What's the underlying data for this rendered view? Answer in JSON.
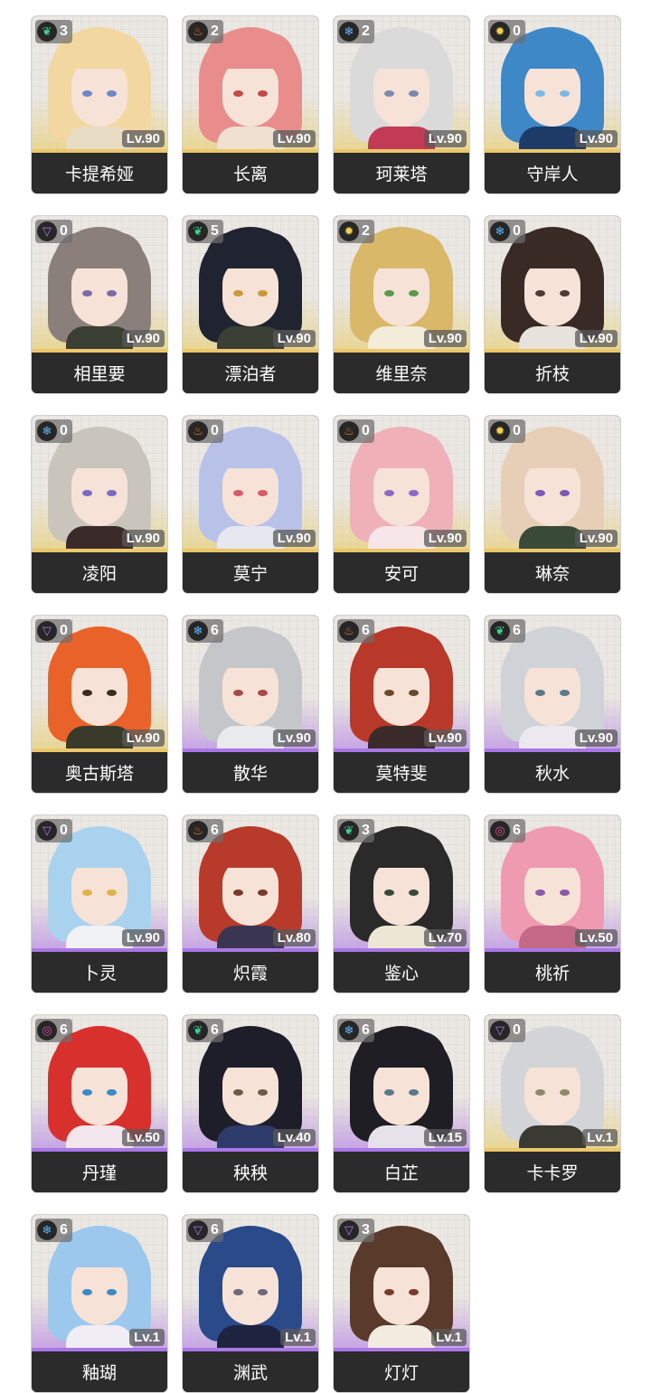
{
  "elements": {
    "glacio": {
      "icon": "snowflake-icon",
      "glyph": "❄",
      "color": "#5fb8ff"
    },
    "fusion": {
      "icon": "flame-icon",
      "glyph": "♨",
      "color": "#f07a2c"
    },
    "electro": {
      "icon": "electro-icon",
      "glyph": "▽",
      "color": "#b37af5"
    },
    "aero": {
      "icon": "wind-icon",
      "glyph": "❦",
      "color": "#3fd18f"
    },
    "spectro": {
      "icon": "sun-icon",
      "glyph": "✹",
      "color": "#f2d04a"
    },
    "havoc": {
      "icon": "havoc-icon",
      "glyph": "◎",
      "color": "#e14c9b"
    }
  },
  "characters": [
    {
      "name": "卡提希娅",
      "level": "Lv.90",
      "chain": "3",
      "element": "aero",
      "rarity": 5,
      "hair": "#f2d8a0",
      "eyes": "#6f86c8",
      "outfit": "#e9dcc5"
    },
    {
      "name": "长离",
      "level": "Lv.90",
      "chain": "2",
      "element": "fusion",
      "rarity": 5,
      "hair": "#e98c8c",
      "eyes": "#c44a4a",
      "outfit": "#f0e0d0"
    },
    {
      "name": "珂莱塔",
      "level": "Lv.90",
      "chain": "2",
      "element": "glacio",
      "rarity": 5,
      "hair": "#dadada",
      "eyes": "#7a8aa8",
      "outfit": "#c23a55"
    },
    {
      "name": "守岸人",
      "level": "Lv.90",
      "chain": "0",
      "element": "spectro",
      "rarity": 5,
      "hair": "#3f88c8",
      "eyes": "#7ab8e8",
      "outfit": "#1e3a66"
    },
    {
      "name": "相里要",
      "level": "Lv.90",
      "chain": "0",
      "element": "electro",
      "rarity": 5,
      "hair": "#8a7f7a",
      "eyes": "#7a6aa8",
      "outfit": "#3b3f33"
    },
    {
      "name": "漂泊者",
      "level": "Lv.90",
      "chain": "5",
      "element": "aero",
      "rarity": 5,
      "hair": "#1f2430",
      "eyes": "#c89a3a",
      "outfit": "#3b3f33"
    },
    {
      "name": "维里奈",
      "level": "Lv.90",
      "chain": "2",
      "element": "spectro",
      "rarity": 5,
      "hair": "#d9b86a",
      "eyes": "#5a9a4a",
      "outfit": "#f2ecd8"
    },
    {
      "name": "折枝",
      "level": "Lv.90",
      "chain": "0",
      "element": "glacio",
      "rarity": 5,
      "hair": "#3a2a26",
      "eyes": "#4a3a38",
      "outfit": "#e8e2dc"
    },
    {
      "name": "凌阳",
      "level": "Lv.90",
      "chain": "0",
      "element": "glacio",
      "rarity": 5,
      "hair": "#c9c4bc",
      "eyes": "#7a6ac8",
      "outfit": "#3a2a2a"
    },
    {
      "name": "莫宁",
      "level": "Lv.90",
      "chain": "0",
      "element": "fusion",
      "rarity": 5,
      "hair": "#b8c2e8",
      "eyes": "#d85a6a",
      "outfit": "#e6e8f0"
    },
    {
      "name": "安可",
      "level": "Lv.90",
      "chain": "0",
      "element": "fusion",
      "rarity": 5,
      "hair": "#f0b0b8",
      "eyes": "#8a6ac8",
      "outfit": "#f6e6ea"
    },
    {
      "name": "琳奈",
      "level": "Lv.90",
      "chain": "0",
      "element": "spectro",
      "rarity": 5,
      "hair": "#e6cfb6",
      "eyes": "#7a5ab8",
      "outfit": "#3a4a38"
    },
    {
      "name": "奥古斯塔",
      "level": "Lv.90",
      "chain": "0",
      "element": "electro",
      "rarity": 5,
      "hair": "#e8622a",
      "eyes": "#3a2a20",
      "outfit": "#3a3a2a"
    },
    {
      "name": "散华",
      "level": "Lv.90",
      "chain": "6",
      "element": "glacio",
      "rarity": 4,
      "hair": "#c4c6ca",
      "eyes": "#a84a4a",
      "outfit": "#e8eaee"
    },
    {
      "name": "莫特斐",
      "level": "Lv.90",
      "chain": "6",
      "element": "fusion",
      "rarity": 4,
      "hair": "#b8382a",
      "eyes": "#6a4a2a",
      "outfit": "#3a2a2a"
    },
    {
      "name": "秋水",
      "level": "Lv.90",
      "chain": "6",
      "element": "aero",
      "rarity": 4,
      "hair": "#cfd2d6",
      "eyes": "#5a7a8a",
      "outfit": "#ece8f0"
    },
    {
      "name": "卜灵",
      "level": "Lv.90",
      "chain": "0",
      "element": "electro",
      "rarity": 4,
      "hair": "#a8d2ee",
      "eyes": "#e0b24a",
      "outfit": "#f0f2f6"
    },
    {
      "name": "炽霞",
      "level": "Lv.80",
      "chain": "6",
      "element": "fusion",
      "rarity": 4,
      "hair": "#b83a2a",
      "eyes": "#7a3a2a",
      "outfit": "#3a3550"
    },
    {
      "name": "鉴心",
      "level": "Lv.70",
      "chain": "3",
      "element": "aero",
      "rarity": 4,
      "hair": "#2a2a2a",
      "eyes": "#3a4a3a",
      "outfit": "#ece6d4"
    },
    {
      "name": "桃祈",
      "level": "Lv.50",
      "chain": "6",
      "element": "havoc",
      "rarity": 4,
      "hair": "#ee9ab0",
      "eyes": "#8a5aa8",
      "outfit": "#c46a88"
    },
    {
      "name": "丹瑾",
      "level": "Lv.50",
      "chain": "6",
      "element": "havoc",
      "rarity": 4,
      "hair": "#d8302c",
      "eyes": "#3a8ac8",
      "outfit": "#f2e6ec"
    },
    {
      "name": "秧秧",
      "level": "Lv.40",
      "chain": "6",
      "element": "aero",
      "rarity": 4,
      "hair": "#1e1e2a",
      "eyes": "#6a5a48",
      "outfit": "#2e3a6a"
    },
    {
      "name": "白芷",
      "level": "Lv.15",
      "chain": "6",
      "element": "glacio",
      "rarity": 4,
      "hair": "#1e1e24",
      "eyes": "#5a7a8a",
      "outfit": "#e6e2ea"
    },
    {
      "name": "卡卡罗",
      "level": "Lv.1",
      "chain": "0",
      "element": "electro",
      "rarity": 5,
      "hair": "#d2d4d8",
      "eyes": "#8a8a6a",
      "outfit": "#3a3a32"
    },
    {
      "name": "釉瑚",
      "level": "Lv.1",
      "chain": "6",
      "element": "glacio",
      "rarity": 4,
      "hair": "#9cc8ee",
      "eyes": "#3a8ac8",
      "outfit": "#f0eef4"
    },
    {
      "name": "渊武",
      "level": "Lv.1",
      "chain": "6",
      "element": "electro",
      "rarity": 4,
      "hair": "#2a4a8a",
      "eyes": "#6a6a7a",
      "outfit": "#1e2440"
    },
    {
      "name": "灯灯",
      "level": "Lv.1",
      "chain": "3",
      "element": "electro",
      "rarity": 4,
      "hair": "#5a3a2a",
      "eyes": "#7a3a2a",
      "outfit": "#f2ebe0"
    }
  ]
}
